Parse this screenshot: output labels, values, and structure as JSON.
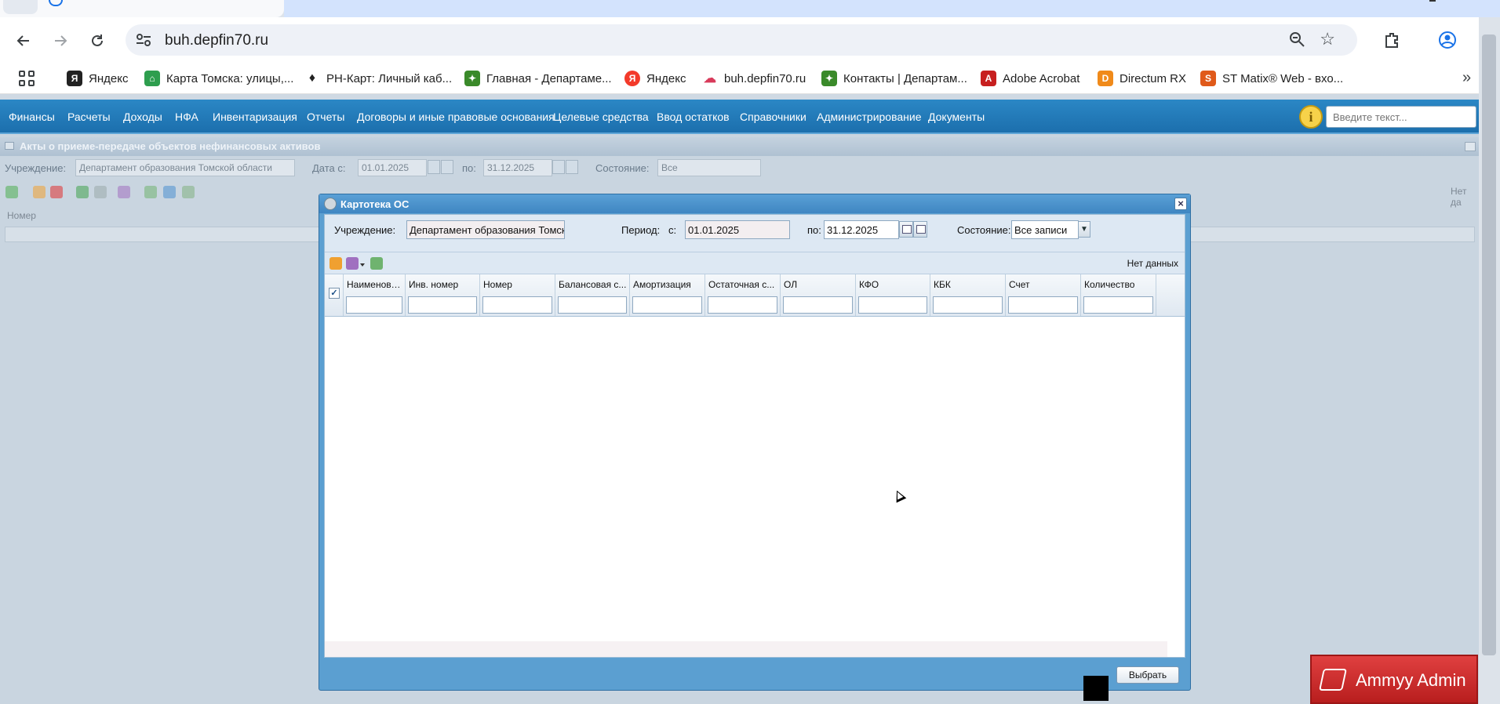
{
  "browser": {
    "url": "buh.depfin70.ru",
    "bookmarks": [
      {
        "label": "Яндекс",
        "icon": "yandex-icon",
        "color": "#222222"
      },
      {
        "label": "Карта Томска: улицы,...",
        "icon": "map-icon",
        "color": "#2e9e4e"
      },
      {
        "label": "РН-Карт: Личный каб...",
        "icon": "rn-kart-icon",
        "color": "#222222"
      },
      {
        "label": "Главная - Департаме...",
        "icon": "emblem-icon",
        "color": "#3a8a2a"
      },
      {
        "label": "Яндекс",
        "icon": "yandex-icon",
        "color": "#f33a2a"
      },
      {
        "label": "buh.depfin70.ru",
        "icon": "cloud-icon",
        "color": "#d83a5a"
      },
      {
        "label": "Контакты | Департам...",
        "icon": "emblem-icon",
        "color": "#3a8a2a"
      },
      {
        "label": "Adobe Acrobat",
        "icon": "acrobat-icon",
        "color": "#c71f1f"
      },
      {
        "label": "Directum RX",
        "icon": "directum-icon",
        "color": "#f08a1a"
      },
      {
        "label": "ST Matix® Web - вхо...",
        "icon": "st-matix-icon",
        "color": "#e05a1a"
      }
    ],
    "more_icon": "»"
  },
  "app": {
    "menu": [
      "Финансы",
      "Расчеты",
      "Доходы",
      "НФА",
      "Инвентаризация",
      "Отчеты",
      "Договоры и иные правовые основания",
      "Целевые средства",
      "Ввод остатков",
      "Справочники",
      "Администрирование",
      "Документы"
    ],
    "info_icon": "i",
    "search_placeholder": "Введите текст..."
  },
  "background_panel": {
    "title": "Акты о приеме-передаче объектов нефинансовых активов",
    "institution_label": "Учреждение:",
    "institution_value": "Департамент образования Томской области",
    "date_from_label": "Дата с:",
    "date_from": "01.01.2025",
    "date_to_label": "по:",
    "date_to": "31.12.2025",
    "status_label": "Состояние:",
    "status_value": "Все",
    "no_data": "Нет да",
    "column_number": "Номер"
  },
  "modal": {
    "title": "Картотека ОС",
    "close": "×",
    "institution_label": "Учреждение:",
    "institution_value": "Департамент образования Томск",
    "period_label": "Период:",
    "from_label": "с:",
    "from_value": "01.01.2025",
    "to_label": "по:",
    "to_value": "31.12.2025",
    "status_label": "Состояние:",
    "status_value": "Все записи",
    "no_data": "Нет данных",
    "check_mark": "✓",
    "columns": [
      "Наименование",
      "Инв. номер",
      "Номер",
      "Балансовая с...",
      "Амортизация",
      "Остаточная с...",
      "ОЛ",
      "КФО",
      "КБК",
      "Счет",
      "Количество"
    ],
    "select_button": "Выбрать"
  },
  "ammyy": {
    "label": "Ammyy Admin"
  }
}
